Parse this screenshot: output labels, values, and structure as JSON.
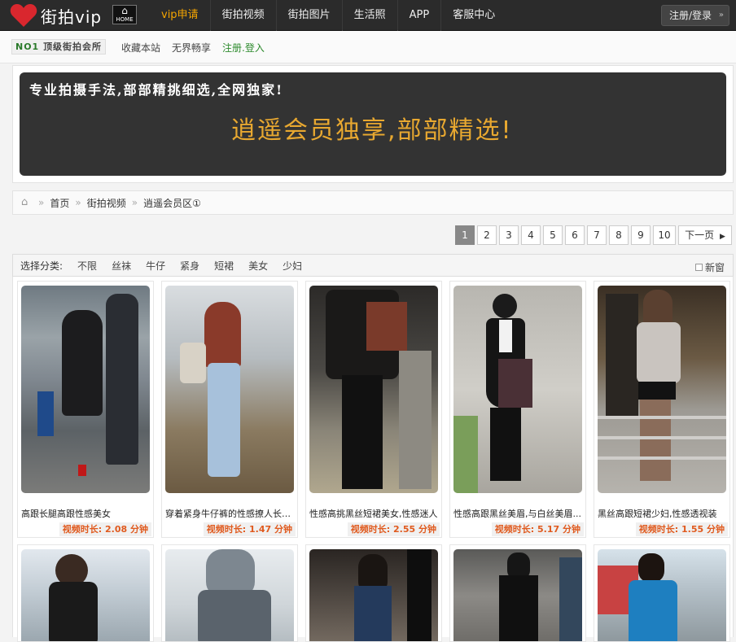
{
  "header": {
    "logo_text": "街拍vip",
    "home_badge": "HOME",
    "nav": [
      {
        "label": "vip申请",
        "active": true
      },
      {
        "label": "街拍视频",
        "active": false
      },
      {
        "label": "街拍图片",
        "active": false
      },
      {
        "label": "生活照",
        "active": false
      },
      {
        "label": "APP",
        "active": false
      },
      {
        "label": "客服中心",
        "active": false
      }
    ],
    "login_label": "注册/登录"
  },
  "subbar": {
    "badge_prefix": "NO1",
    "badge_text": "顶级街拍会所",
    "links": [
      "收藏本站",
      "无界畅享",
      "注册.登入"
    ]
  },
  "banner": {
    "line1": "专业拍摄手法,部部精挑细选,全网独家!",
    "line2": "逍遥会员独享,部部精选!"
  },
  "breadcrumb": [
    "首页",
    "街拍视频",
    "逍遥会员区①"
  ],
  "pagination": {
    "pages": [
      "1",
      "2",
      "3",
      "4",
      "5",
      "6",
      "7",
      "8",
      "9",
      "10"
    ],
    "current": "1",
    "next_label": "下一页"
  },
  "filter": {
    "label": "选择分类:",
    "categories": [
      "不限",
      "丝袜",
      "牛仔",
      "紧身",
      "短裙",
      "美女",
      "少妇"
    ],
    "new_window_label": "新窗"
  },
  "videos": [
    {
      "title": "高跟长腿高跟性感美女",
      "duration": "视频时长: 2.08 分钟"
    },
    {
      "title": "穿着紧身牛仔裤的性感撩人长腿...",
      "duration": "视频时长: 1.47 分钟"
    },
    {
      "title": "性感高挑黑丝短裙美女,性感迷人",
      "duration": "视频时长: 2.55 分钟"
    },
    {
      "title": "性感高跟黑丝美眉,与白丝美眉...",
      "duration": "视频时长: 5.17 分钟"
    },
    {
      "title": "黑丝高跟短裙少妇,性感透视装",
      "duration": "视频时长: 1.55 分钟"
    }
  ],
  "colors": {
    "topbar": "#2b2b2b",
    "active_nav": "#f5a500",
    "banner_bg": "#333333",
    "banner_gold": "#e8a830",
    "duration": "#e05a1e"
  }
}
